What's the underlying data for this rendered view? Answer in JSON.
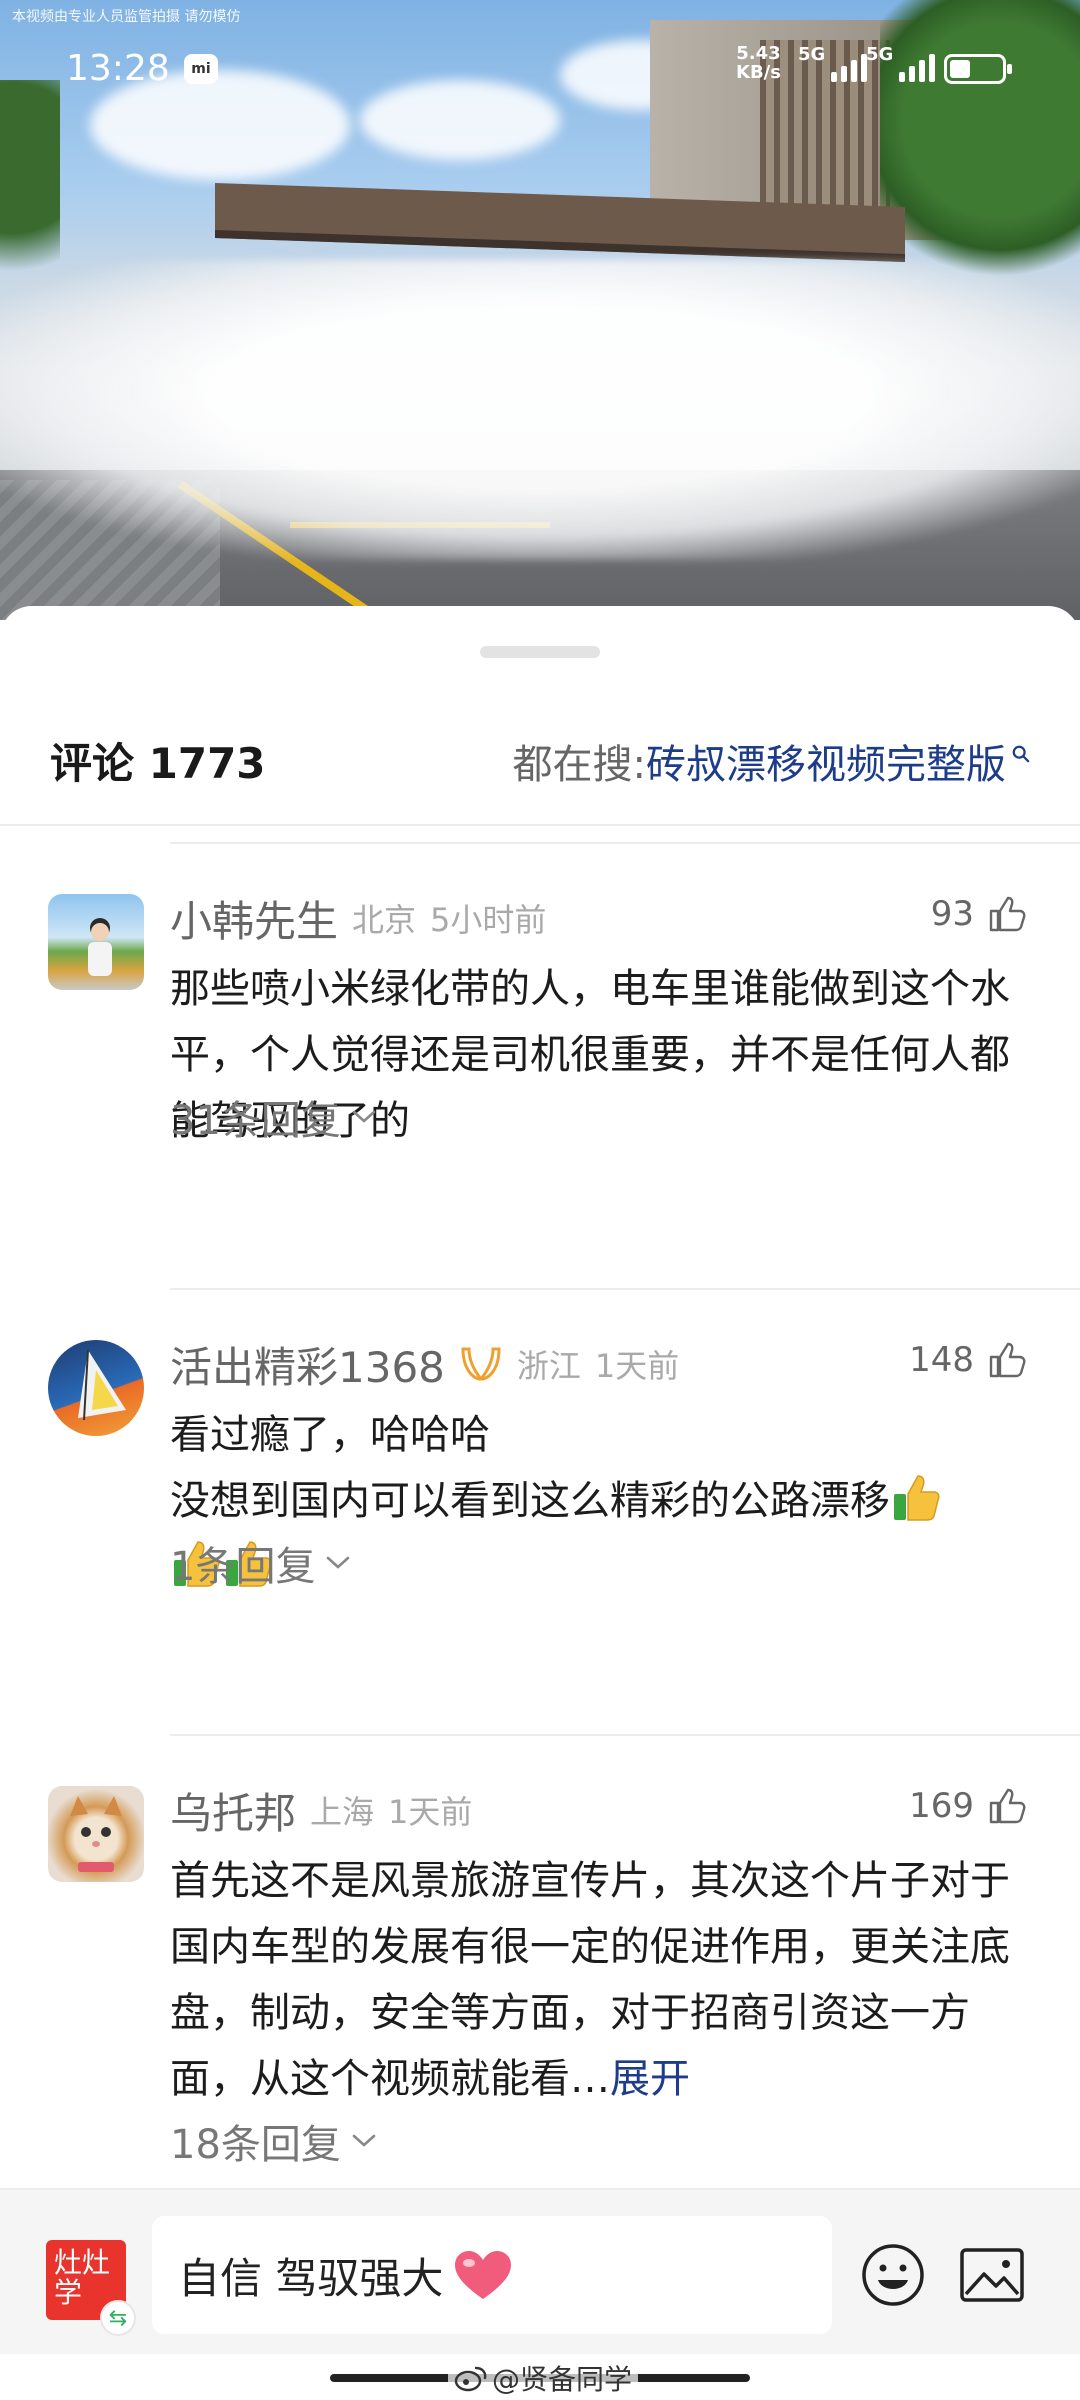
{
  "video": {
    "watermark": "本视频由专业人员监管拍摄 请勿模仿"
  },
  "status_bar": {
    "time": "13:28",
    "carrier_badge": "mi",
    "net_speed_value": "5.43",
    "net_speed_unit": "KB/s",
    "sim1": "5G",
    "sim2": "5G",
    "battery_level": 0.4
  },
  "comments_header": {
    "title": "评论 1773",
    "hot_search_prefix": "都在搜: ",
    "hot_search_keyword": "砖叔漂移视频完整版"
  },
  "comments": [
    {
      "username": "小韩先生",
      "location": "北京",
      "time": "5小时前",
      "likes": "93",
      "text": "那些喷小米绿化带的人，电车里谁能做到这个水平，个人觉得还是司机很重要，并不是任何人都能驾驭的了的",
      "replies": "31条回复"
    },
    {
      "username": "活出精彩1368",
      "location": "浙江",
      "time": "1天前",
      "likes": "148",
      "text_line1": "看过瘾了，哈哈哈",
      "text_line2": "没想到国内可以看到这么精彩的公路漂移",
      "replies": "1条回复"
    },
    {
      "username": "乌托邦",
      "location": "上海",
      "time": "1天前",
      "likes": "169",
      "text": "首先这不是风景旅游宣传片，其次这个片子对于国内车型的发展有很一定的促进作用，更关注底盘，制动，安全等方面，对于招商引资这一方面，从这个视频就能看…",
      "expand": "展开",
      "replies": "18条回复"
    }
  ],
  "input_bar": {
    "avatar_text": "灶灶学",
    "text": "自信 驾驭强大"
  },
  "footer": {
    "weibo_watermark": "@贤备同学"
  }
}
